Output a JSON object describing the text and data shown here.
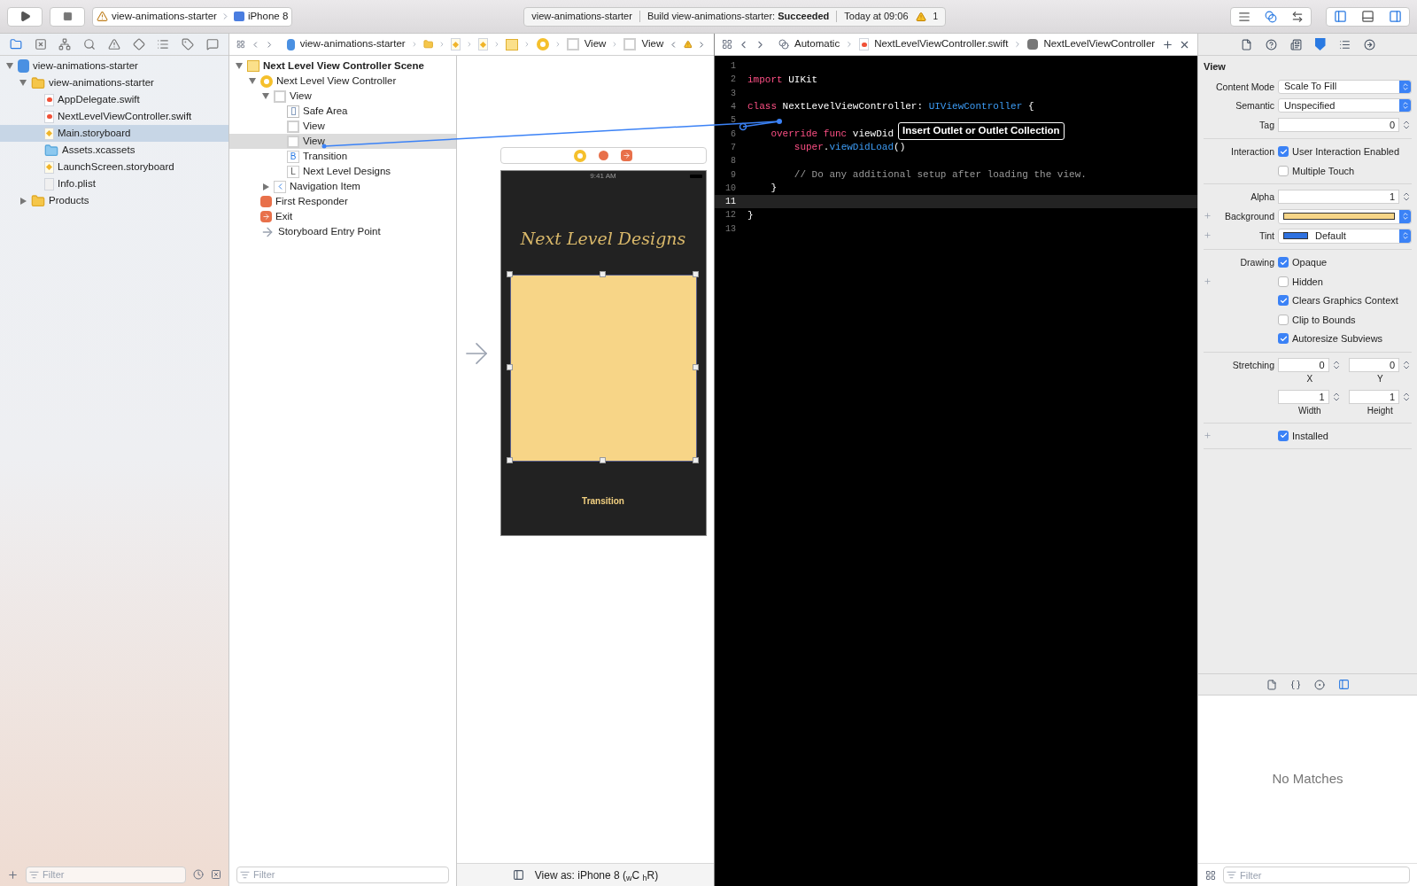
{
  "toolbar": {
    "scheme": "view-animations-starter",
    "device": "iPhone 8",
    "activity": {
      "project": "view-animations-starter",
      "status": "Build view-animations-starter: **Succeeded**",
      "time": "Today at 09:06",
      "warnings": "1"
    }
  },
  "navigator": {
    "items": [
      {
        "label": "view-animations-starter",
        "kind": "project",
        "expanded": true,
        "selected": false,
        "children": [
          {
            "label": "view-animations-starter",
            "kind": "folder",
            "expanded": true,
            "selected": false,
            "children": [
              {
                "label": "AppDelegate.swift",
                "kind": "swift",
                "selected": false
              },
              {
                "label": "NextLevelViewController.swift",
                "kind": "swift",
                "selected": false
              },
              {
                "label": "Main.storyboard",
                "kind": "storyboard",
                "selected": true
              },
              {
                "label": "Assets.xcassets",
                "kind": "assets",
                "selected": false
              },
              {
                "label": "LaunchScreen.storyboard",
                "kind": "storyboard",
                "selected": false
              },
              {
                "label": "Info.plist",
                "kind": "plist",
                "selected": false
              }
            ]
          },
          {
            "label": "Products",
            "kind": "folder",
            "expanded": false,
            "selected": false
          }
        ]
      }
    ],
    "filter_placeholder": "Filter"
  },
  "breadcrumbs": [
    "view-animations-starter",
    "View",
    "View"
  ],
  "outline": {
    "items": [
      {
        "label": "Next Level View Controller Scene",
        "kind": "scene",
        "expanded": true,
        "selected": false,
        "children": [
          {
            "label": "Next Level View Controller",
            "kind": "controller",
            "expanded": true,
            "selected": false,
            "children": [
              {
                "label": "View",
                "kind": "view",
                "expanded": true,
                "selected": false,
                "children": [
                  {
                    "label": "Safe Area",
                    "kind": "safearea",
                    "selected": false
                  },
                  {
                    "label": "View",
                    "kind": "view",
                    "selected": false
                  },
                  {
                    "label": "View",
                    "kind": "view",
                    "selected": true
                  },
                  {
                    "label": "Transition",
                    "kind": "button",
                    "glyph": "B",
                    "selected": false
                  },
                  {
                    "label": "Next Level Designs",
                    "kind": "label",
                    "glyph": "L",
                    "selected": false
                  }
                ]
              },
              {
                "label": "Navigation Item",
                "kind": "navitem",
                "expanded": false,
                "selected": false
              }
            ]
          },
          {
            "label": "First Responder",
            "kind": "responder",
            "selected": false
          },
          {
            "label": "Exit",
            "kind": "exit",
            "selected": false
          },
          {
            "label": "Storyboard Entry Point",
            "kind": "entry",
            "selected": false
          }
        ]
      }
    ],
    "filter_placeholder": "Filter"
  },
  "canvas": {
    "status_time": "9:41 AM",
    "title": "Next Level Designs",
    "button": "Transition",
    "view_as": "View as: iPhone 8 ($_{w}$C $_{h}$R)"
  },
  "editor": {
    "jump": [
      "Automatic",
      "NextLevelViewController.swift",
      "NextLevelViewController"
    ],
    "lines": [
      {
        "number": "1",
        "current": false
      },
      {
        "number": "2",
        "current": false,
        "tokens": [
          {
            "text": "import",
            "kind": "keyword"
          },
          {
            "text": " UIKit",
            "kind": "plain"
          }
        ]
      },
      {
        "number": "3",
        "current": false
      },
      {
        "number": "4",
        "current": false,
        "tokens": [
          {
            "text": "class",
            "kind": "keyword"
          },
          {
            "text": " NextLevelViewController: ",
            "kind": "plain"
          },
          {
            "text": "UIViewController",
            "kind": "type"
          },
          {
            "text": " {",
            "kind": "plain"
          }
        ]
      },
      {
        "number": "5",
        "current": false
      },
      {
        "number": "6",
        "current": false,
        "tokens": [
          {
            "text": "    override func",
            "kind": "keyword"
          },
          {
            "text": " viewDid",
            "kind": "plain"
          }
        ]
      },
      {
        "number": "7",
        "current": false,
        "tokens": [
          {
            "text": "        super",
            "kind": "keyword"
          },
          {
            "text": ".",
            "kind": "plain"
          },
          {
            "text": "viewDidLoad",
            "kind": "type"
          },
          {
            "text": "()",
            "kind": "plain"
          }
        ]
      },
      {
        "number": "8",
        "current": false
      },
      {
        "number": "9",
        "current": false,
        "tokens": [
          {
            "text": "        // Do any additional setup after loading the view.",
            "kind": "comment"
          }
        ]
      },
      {
        "number": "10",
        "current": false,
        "tokens": [
          {
            "text": "    }",
            "kind": "plain"
          }
        ]
      },
      {
        "number": "11",
        "current": true
      },
      {
        "number": "12",
        "current": false,
        "tokens": [
          {
            "text": "}",
            "kind": "plain"
          }
        ]
      },
      {
        "number": "13",
        "current": false
      }
    ],
    "tooltip": "Insert Outlet or Outlet Collection"
  },
  "inspector": {
    "title": "View",
    "groups": [
      {
        "rows": [
          {
            "kind": "select",
            "label": "Content Mode",
            "value": "Scale To Fill",
            "plus": false
          },
          {
            "kind": "select",
            "label": "Semantic",
            "value": "Unspecified",
            "plus": false
          },
          {
            "kind": "number",
            "label": "Tag",
            "value": "0",
            "plus": false
          }
        ]
      },
      {
        "rows": [
          {
            "kind": "checkbox",
            "label": "Interaction",
            "text": "User Interaction Enabled",
            "checked": true,
            "plus": false
          },
          {
            "kind": "checkbox",
            "text": "Multiple Touch",
            "checked": false,
            "plus": false
          }
        ]
      },
      {
        "rows": [
          {
            "kind": "number",
            "label": "Alpha",
            "value": "1",
            "plus": false
          },
          {
            "kind": "color",
            "label": "Background",
            "color": "#f7d587",
            "plus": true
          },
          {
            "kind": "color",
            "label": "Tint",
            "color": "#2f72e0",
            "value": "Default",
            "plus": true
          }
        ]
      },
      {
        "rows": [
          {
            "kind": "checkbox",
            "label": "Drawing",
            "text": "Opaque",
            "checked": true,
            "plus": false
          },
          {
            "kind": "checkbox",
            "text": "Hidden",
            "checked": false,
            "plus": true
          },
          {
            "kind": "checkbox",
            "text": "Clears Graphics Context",
            "checked": true,
            "plus": false
          },
          {
            "kind": "checkbox",
            "text": "Clip to Bounds",
            "checked": false,
            "plus": false
          },
          {
            "kind": "checkbox",
            "text": "Autoresize Subviews",
            "checked": true,
            "plus": false
          }
        ]
      },
      {
        "rows": [
          {
            "kind": "pair",
            "label": "Stretching",
            "fields": [
              {
                "value": "0",
                "caption": "X"
              },
              {
                "value": "0",
                "caption": "Y"
              }
            ],
            "plus": false
          },
          {
            "kind": "pair",
            "fields": [
              {
                "value": "1",
                "caption": "Width"
              },
              {
                "value": "1",
                "caption": "Height"
              }
            ],
            "plus": false
          }
        ]
      },
      {
        "rows": [
          {
            "kind": "checkbox",
            "text": "Installed",
            "checked": true,
            "plus": true
          }
        ]
      }
    ],
    "library": {
      "message": "No Matches",
      "filter_placeholder": "Filter"
    }
  }
}
